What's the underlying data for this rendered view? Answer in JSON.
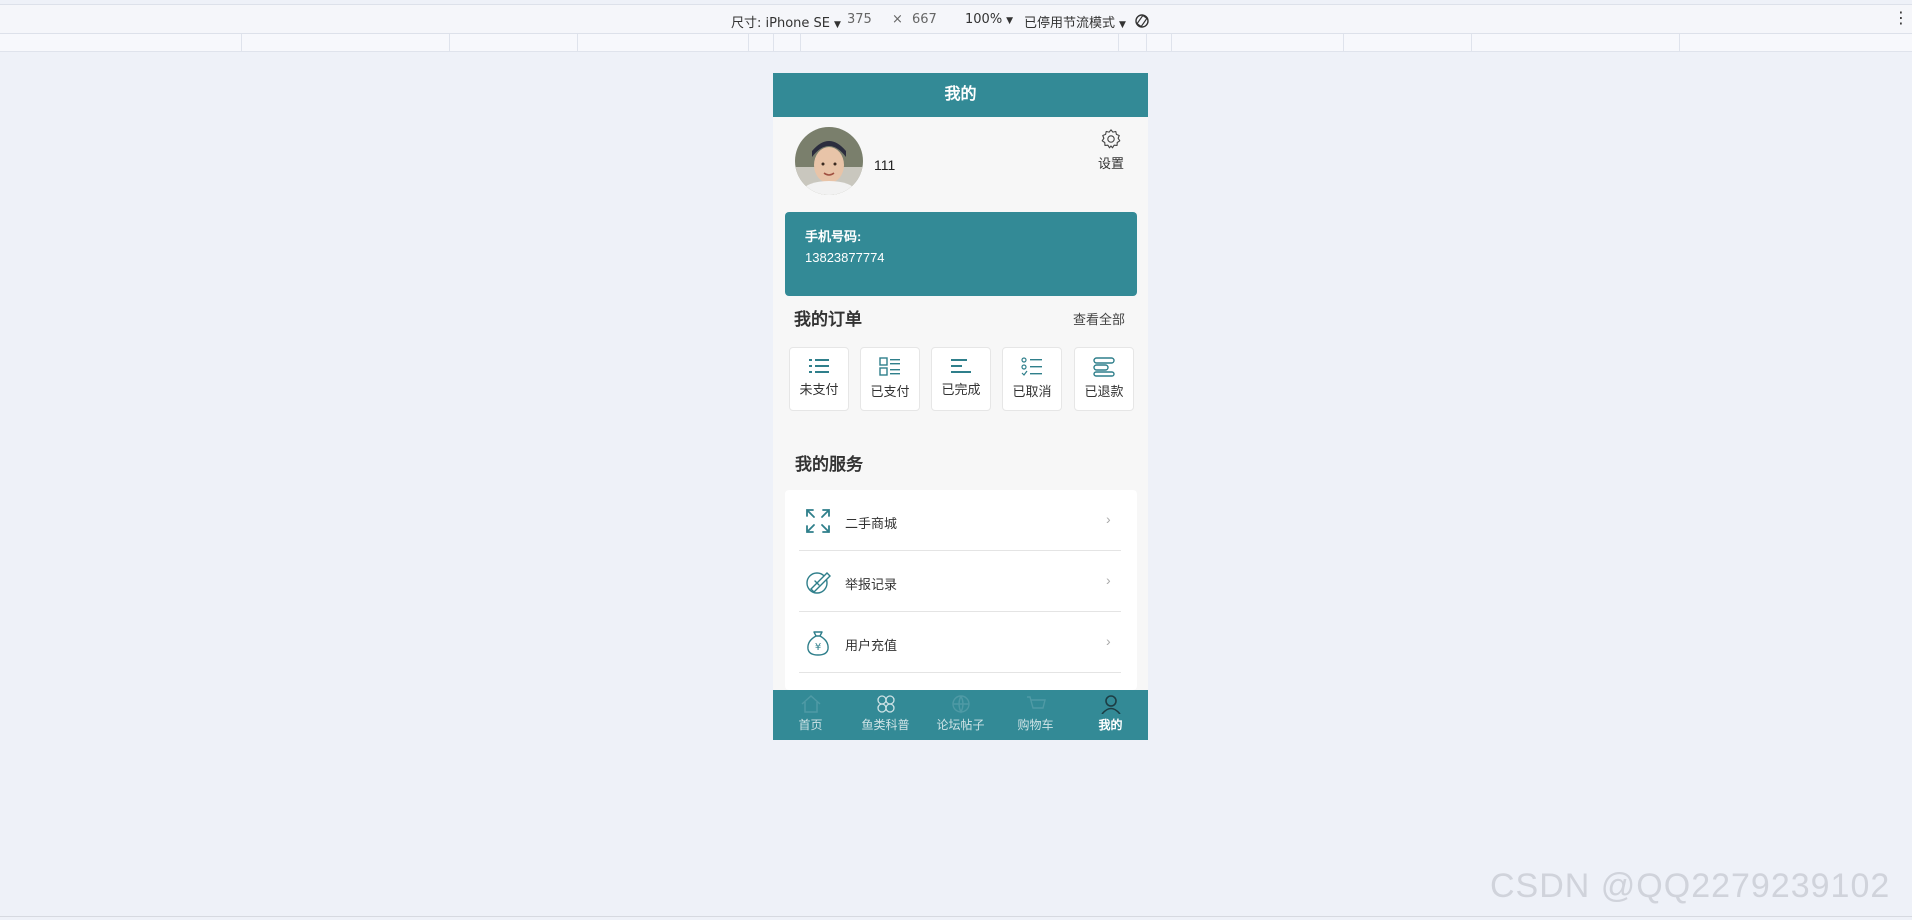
{
  "devtools": {
    "dimensions_label": "尺寸: iPhone SE",
    "width": "375",
    "times": "×",
    "height": "667",
    "zoom": "100%",
    "throttle": "已停用节流模式"
  },
  "app": {
    "nav_title": "我的",
    "profile": {
      "username": "111",
      "settings_label": "设置"
    },
    "phone_card": {
      "label": "手机号码:",
      "number": "13823877774"
    },
    "orders": {
      "title": "我的订单",
      "view_all": "查看全部",
      "tabs": [
        {
          "label": "未支付",
          "icon": "list-icon"
        },
        {
          "label": "已支付",
          "icon": "grid-list-icon"
        },
        {
          "label": "已完成",
          "icon": "align-left-icon"
        },
        {
          "label": "已取消",
          "icon": "checklist-icon"
        },
        {
          "label": "已退款",
          "icon": "stack-icon"
        }
      ]
    },
    "services": {
      "title": "我的服务",
      "items": [
        {
          "label": "二手商城",
          "icon": "expand-arrows-icon"
        },
        {
          "label": "举报记录",
          "icon": "pen-note-icon"
        },
        {
          "label": "用户充值",
          "icon": "money-bag-icon"
        }
      ]
    },
    "tabbar": [
      {
        "label": "首页",
        "icon": "home-icon"
      },
      {
        "label": "鱼类科普",
        "icon": "clover-icon"
      },
      {
        "label": "论坛帖子",
        "icon": "forum-icon"
      },
      {
        "label": "购物车",
        "icon": "cart-icon"
      },
      {
        "label": "我的",
        "icon": "user-icon",
        "active": true
      }
    ],
    "colors": {
      "primary": "#338a96"
    }
  },
  "watermark": "CSDN @QQ2279239102"
}
